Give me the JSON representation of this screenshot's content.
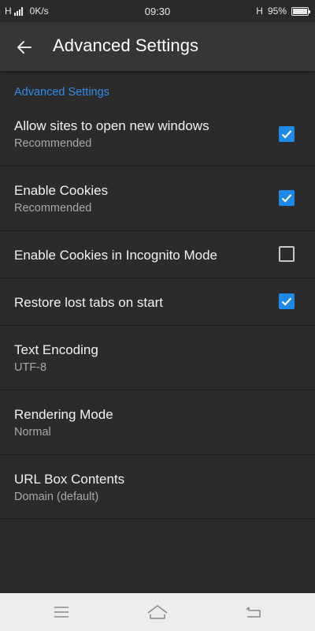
{
  "status_bar": {
    "network": "H",
    "speed": "0K/s",
    "time": "09:30",
    "network_right": "H",
    "battery_percent": "95%",
    "battery_level": 0.95
  },
  "app_bar": {
    "title": "Advanced Settings",
    "back_icon": "arrow-back-icon"
  },
  "section": {
    "header": "Advanced Settings"
  },
  "settings": [
    {
      "title": "Allow sites to open new windows",
      "summary": "Recommended",
      "checked": true
    },
    {
      "title": "Enable Cookies",
      "summary": "Recommended",
      "checked": true
    },
    {
      "title": "Enable Cookies in Incognito Mode",
      "checked": false
    },
    {
      "title": "Restore lost tabs on start",
      "checked": true
    },
    {
      "title": "Text Encoding",
      "summary": "UTF-8"
    },
    {
      "title": "Rendering Mode",
      "summary": "Normal"
    },
    {
      "title": "URL Box Contents",
      "summary": "Domain (default)"
    }
  ],
  "nav_bar": {
    "menu_icon": "menu-icon",
    "home_icon": "home-icon",
    "back_icon": "back-nav-icon"
  },
  "colors": {
    "accent": "#1e88e5",
    "section_header": "#2f8ce8",
    "background": "#2b2b2b",
    "app_bar": "#363636"
  }
}
